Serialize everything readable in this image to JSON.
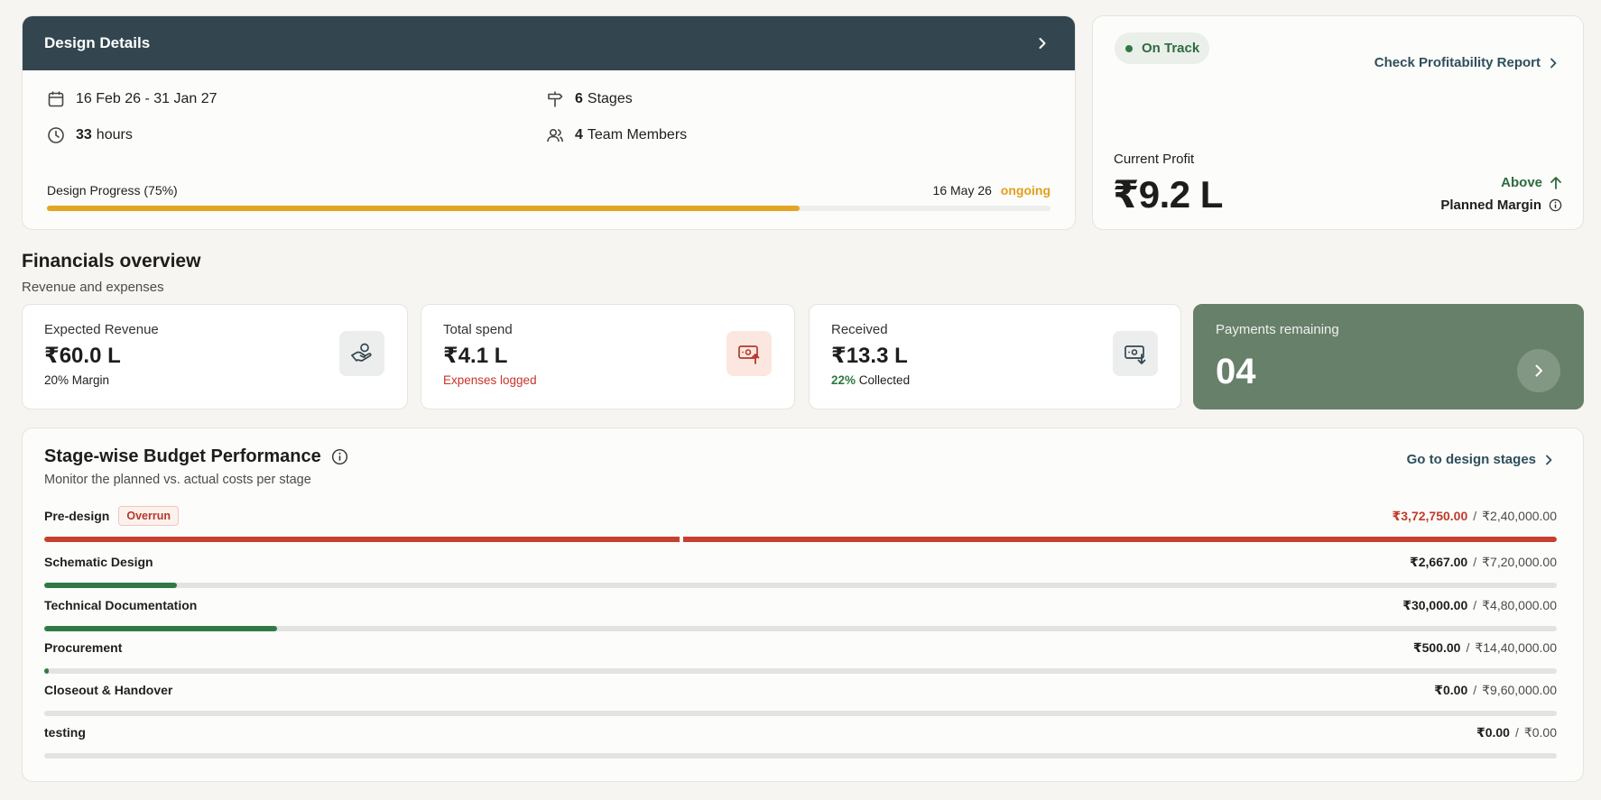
{
  "design": {
    "title": "Design Details",
    "date_range": "16 Feb 26 - 31 Jan 27",
    "hours_value": "33",
    "hours_label": "hours",
    "stages_value": "6",
    "stages_label": "Stages",
    "team_value": "4",
    "team_label": "Team Members",
    "progress_label": "Design Progress (75%)",
    "progress": 0.75,
    "progress_date": "16 May 26",
    "progress_status": "ongoing"
  },
  "profit": {
    "status": "On Track",
    "report_link": "Check Profitability Report",
    "current_label": "Current Profit",
    "current_value": "₹9.2 L",
    "comparison": "Above",
    "comparison_label": "Planned Margin"
  },
  "financials": {
    "title": "Financials overview",
    "subtitle": "Revenue and expenses",
    "revenue": {
      "label": "Expected Revenue",
      "value": "₹60.0 L",
      "sub": "20% Margin",
      "icon": "handshake-money-icon"
    },
    "spend": {
      "label": "Total spend",
      "value": "₹4.1 L",
      "sub": "Expenses logged",
      "icon": "cash-out-icon"
    },
    "received": {
      "label": "Received",
      "value": "₹13.3 L",
      "sub_pct": "22%",
      "sub_text": "Collected",
      "icon": "cash-in-icon"
    },
    "payments": {
      "label": "Payments remaining",
      "value": "04"
    }
  },
  "stages": {
    "title": "Stage-wise Budget Performance",
    "subtitle": "Monitor the planned vs. actual costs per stage",
    "link": "Go to design stages",
    "sep": "/",
    "items": [
      {
        "name": "Pre-design",
        "badge": "Overrun",
        "actual": "₹3,72,750.00",
        "planned": "₹2,40,000.00",
        "progress": 1.0,
        "overrun": true,
        "planned_mark": 0.42
      },
      {
        "name": "Schematic Design",
        "badge": "",
        "actual": "₹2,667.00",
        "planned": "₹7,20,000.00",
        "progress": 0.088,
        "overrun": false
      },
      {
        "name": "Technical Documentation",
        "badge": "",
        "actual": "₹30,000.00",
        "planned": "₹4,80,000.00",
        "progress": 0.154,
        "overrun": false
      },
      {
        "name": "Procurement",
        "badge": "",
        "actual": "₹500.00",
        "planned": "₹14,40,000.00",
        "progress": 0.002,
        "overrun": false
      },
      {
        "name": "Closeout & Handover",
        "badge": "",
        "actual": "₹0.00",
        "planned": "₹9,60,000.00",
        "progress": 0,
        "overrun": false
      },
      {
        "name": "testing",
        "badge": "",
        "actual": "₹0.00",
        "planned": "₹0.00",
        "progress": 0,
        "overrun": false
      }
    ]
  },
  "colors": {
    "header": "#33464f",
    "progress": "#e2a524",
    "green": "#2f7a44",
    "red": "#c6402f",
    "payments_bg": "#67806a"
  }
}
